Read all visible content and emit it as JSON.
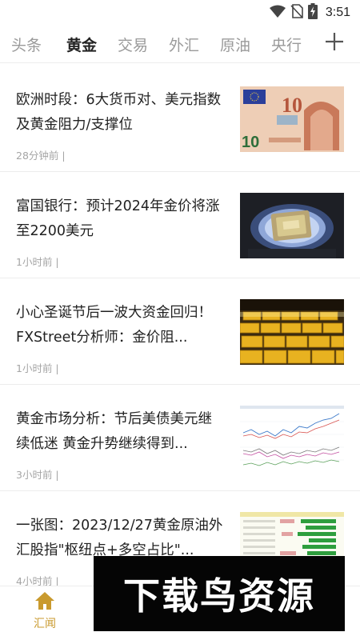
{
  "status_bar": {
    "time": "3:51",
    "icons": [
      "wifi-icon",
      "no-sim-icon",
      "battery-charging-icon"
    ]
  },
  "tabs": [
    {
      "label": "头条",
      "active": false
    },
    {
      "label": "黄金",
      "active": true
    },
    {
      "label": "交易",
      "active": false
    },
    {
      "label": "外汇",
      "active": false
    },
    {
      "label": "原油",
      "active": false
    },
    {
      "label": "央行",
      "active": false
    }
  ],
  "tab_add_icon": "plus-icon",
  "news": [
    {
      "title": "欧洲时段：6大货币对、美元指数及黄金阻力/支撑位",
      "meta": "28分钟前 |",
      "thumb": "euro-banknote-image"
    },
    {
      "title": "富国银行：预计2024年金价将涨至2200美元",
      "meta": "1小时前 |",
      "thumb": "gold-bar-image"
    },
    {
      "title": "小心圣诞节后一波大资金回归！FXStreet分析师：金价阻...",
      "meta": "1小时前 |",
      "thumb": "gold-bars-stack-image"
    },
    {
      "title": "黄金市场分析：节后美债美元继续低迷 黄金升势继续得到...",
      "meta": "3小时前 |",
      "thumb": "market-chart-image"
    },
    {
      "title": "一张图：2023/12/27黄金原油外汇股指\"枢纽点+多空占比\"...",
      "meta": "4小时前 |",
      "thumb": "pivot-table-image"
    }
  ],
  "bottom_nav": {
    "home_label": "汇闻",
    "home_icon": "home-icon",
    "accent_color": "#c99a2e"
  },
  "watermark": {
    "text": "下载鸟资源"
  }
}
